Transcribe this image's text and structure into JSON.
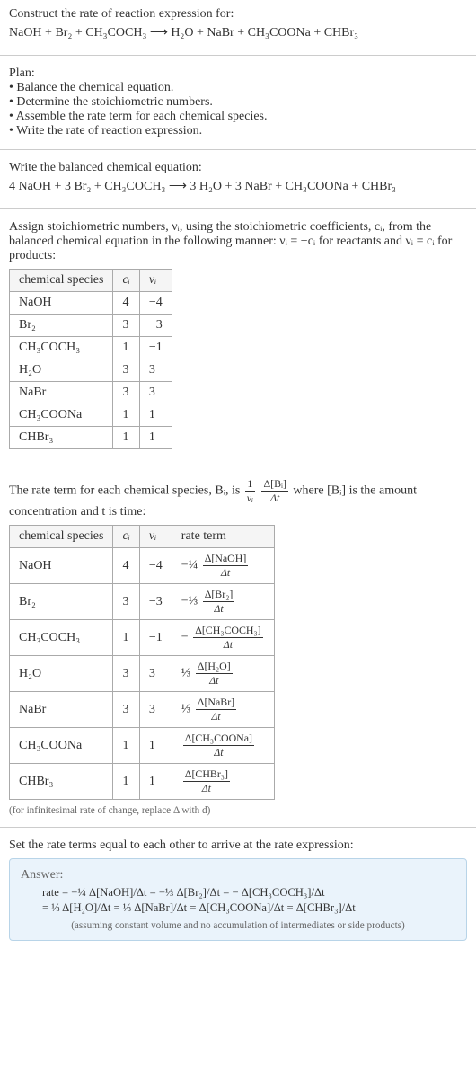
{
  "title": "Construct the rate of reaction expression for:",
  "eq_unbalanced": "NaOH + Br₂ + CH₃COCH₃  ⟶  H₂O + NaBr + CH₃COONa + CHBr₃",
  "plan_label": "Plan:",
  "plan_items": [
    "• Balance the chemical equation.",
    "• Determine the stoichiometric numbers.",
    "• Assemble the rate term for each chemical species.",
    "• Write the rate of reaction expression."
  ],
  "balanced_label": "Write the balanced chemical equation:",
  "eq_balanced": "4 NaOH + 3 Br₂ + CH₃COCH₃  ⟶  3 H₂O + 3 NaBr + CH₃COONa + CHBr₃",
  "stoich_intro_1": "Assign stoichiometric numbers, νᵢ, using the stoichiometric coefficients, cᵢ, from the balanced chemical equation in the following manner: νᵢ = −cᵢ for reactants and νᵢ = cᵢ for products:",
  "table1": {
    "headers": [
      "chemical species",
      "cᵢ",
      "νᵢ"
    ],
    "rows": [
      [
        "NaOH",
        "4",
        "−4"
      ],
      [
        "Br₂",
        "3",
        "−3"
      ],
      [
        "CH₃COCH₃",
        "1",
        "−1"
      ],
      [
        "H₂O",
        "3",
        "3"
      ],
      [
        "NaBr",
        "3",
        "3"
      ],
      [
        "CH₃COONa",
        "1",
        "1"
      ],
      [
        "CHBr₃",
        "1",
        "1"
      ]
    ]
  },
  "rate_intro_1": "The rate term for each chemical species, Bᵢ, is",
  "rate_intro_2": "where [Bᵢ] is the amount concentration and t is time:",
  "table2": {
    "headers": [
      "chemical species",
      "cᵢ",
      "νᵢ",
      "rate term"
    ],
    "rows": [
      {
        "sp": "NaOH",
        "c": "4",
        "v": "−4",
        "coef": "−¼",
        "d": "Δ[NaOH]"
      },
      {
        "sp": "Br₂",
        "c": "3",
        "v": "−3",
        "coef": "−⅓",
        "d": "Δ[Br₂]"
      },
      {
        "sp": "CH₃COCH₃",
        "c": "1",
        "v": "−1",
        "coef": "−",
        "d": "Δ[CH₃COCH₃]"
      },
      {
        "sp": "H₂O",
        "c": "3",
        "v": "3",
        "coef": "⅓",
        "d": "Δ[H₂O]"
      },
      {
        "sp": "NaBr",
        "c": "3",
        "v": "3",
        "coef": "⅓",
        "d": "Δ[NaBr]"
      },
      {
        "sp": "CH₃COONa",
        "c": "1",
        "v": "1",
        "coef": "",
        "d": "Δ[CH₃COONa]"
      },
      {
        "sp": "CHBr₃",
        "c": "1",
        "v": "1",
        "coef": "",
        "d": "Δ[CHBr₃]"
      }
    ]
  },
  "infinitesimal_note": "(for infinitesimal rate of change, replace Δ with d)",
  "final_label": "Set the rate terms equal to each other to arrive at the rate expression:",
  "answer_label": "Answer:",
  "rate_eq_line1": "rate = −¼ Δ[NaOH]/Δt = −⅓ Δ[Br₂]/Δt = − Δ[CH₃COCH₃]/Δt",
  "rate_eq_line2": "= ⅓ Δ[H₂O]/Δt = ⅓ Δ[NaBr]/Δt = Δ[CH₃COONa]/Δt = Δ[CHBr₃]/Δt",
  "assumption": "(assuming constant volume and no accumulation of intermediates or side products)",
  "dt": "Δt",
  "one_over_nu_num": "1",
  "one_over_nu_den": "νᵢ",
  "dBi_num": "Δ[Bᵢ]",
  "dBi_den": "Δt",
  "chart_data": {
    "type": "table",
    "tables": [
      {
        "title": "Stoichiometric numbers",
        "columns": [
          "chemical species",
          "c_i",
          "ν_i"
        ],
        "rows": [
          [
            "NaOH",
            4,
            -4
          ],
          [
            "Br2",
            3,
            -3
          ],
          [
            "CH3COCH3",
            1,
            -1
          ],
          [
            "H2O",
            3,
            3
          ],
          [
            "NaBr",
            3,
            3
          ],
          [
            "CH3COONa",
            1,
            1
          ],
          [
            "CHBr3",
            1,
            1
          ]
        ]
      },
      {
        "title": "Rate terms",
        "columns": [
          "chemical species",
          "c_i",
          "ν_i",
          "rate term"
        ],
        "rows": [
          [
            "NaOH",
            4,
            -4,
            "-(1/4) d[NaOH]/dt"
          ],
          [
            "Br2",
            3,
            -3,
            "-(1/3) d[Br2]/dt"
          ],
          [
            "CH3COCH3",
            1,
            -1,
            "- d[CH3COCH3]/dt"
          ],
          [
            "H2O",
            3,
            3,
            "(1/3) d[H2O]/dt"
          ],
          [
            "NaBr",
            3,
            3,
            "(1/3) d[NaBr]/dt"
          ],
          [
            "CH3COONa",
            1,
            1,
            "d[CH3COONa]/dt"
          ],
          [
            "CHBr3",
            1,
            1,
            "d[CHBr3]/dt"
          ]
        ]
      }
    ]
  }
}
